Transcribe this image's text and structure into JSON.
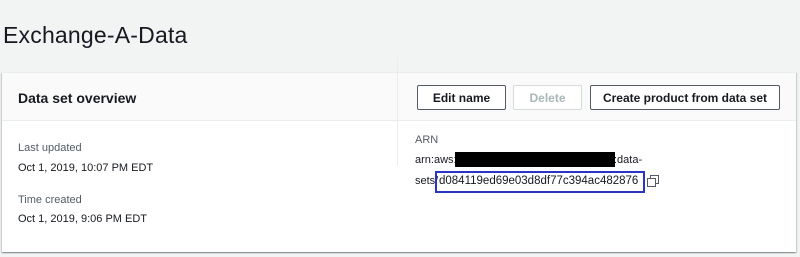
{
  "page": {
    "title": "Exchange-A-Data"
  },
  "overview": {
    "heading": "Data set overview",
    "buttons": {
      "edit_name": "Edit name",
      "delete": "Delete",
      "create_product": "Create product from data set"
    },
    "last_updated": {
      "label": "Last updated",
      "value": "Oct 1, 2019, 10:07 PM EDT"
    },
    "time_created": {
      "label": "Time created",
      "value": "Oct 1, 2019, 9:06 PM EDT"
    },
    "arn": {
      "label": "ARN",
      "prefix": "arn:aws:",
      "suffix_line1": ":data-",
      "line2_prefix": "sets/",
      "dataset_id": "d084119ed69e03d8df77c394ac482876"
    }
  }
}
